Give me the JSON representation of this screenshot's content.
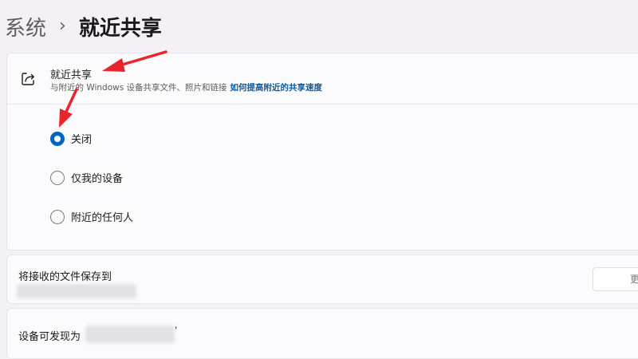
{
  "breadcrumb": {
    "parent": "系统",
    "separator": "›",
    "current": "就近共享"
  },
  "nearby": {
    "title": "就近共享",
    "description": "与附近的 Windows 设备共享文件、照片和链接",
    "link": "如何提高附近的共享速度",
    "options": [
      {
        "label": "关闭",
        "checked": true
      },
      {
        "label": "仅我的设备",
        "checked": false
      },
      {
        "label": "附近的任何人",
        "checked": false
      }
    ]
  },
  "save": {
    "label": "将接收的文件保存到",
    "button_label": "更"
  },
  "discover": {
    "label": "设备可发现为",
    "suffix": "'"
  },
  "colors": {
    "accent": "#0067c0",
    "link": "#0f5aa0",
    "annotation": "#e8242c"
  }
}
